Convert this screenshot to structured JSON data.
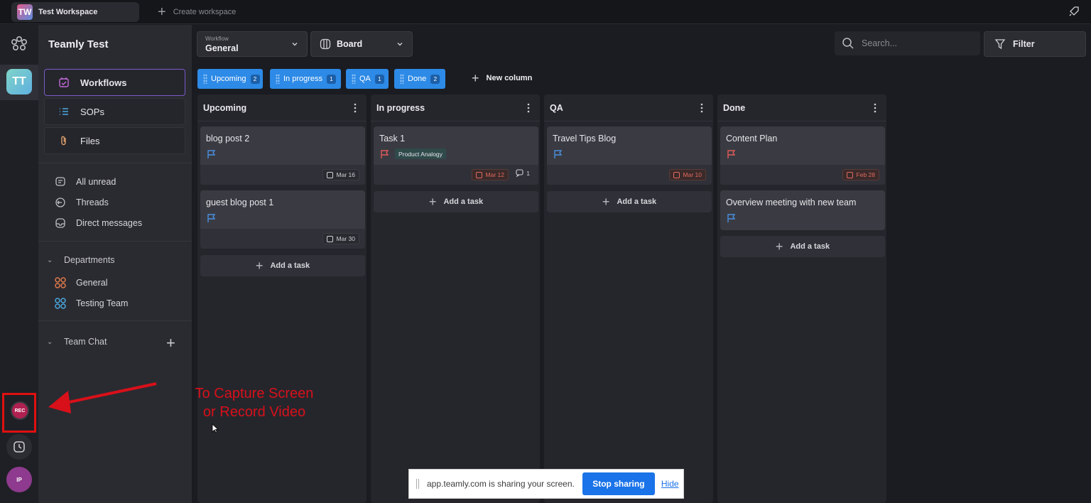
{
  "topbar": {
    "workspace_badge": "TW",
    "workspace_name": "Test Workspace",
    "create_workspace": "Create workspace"
  },
  "rail": {
    "team_badge": "TT",
    "rec_label": "REC",
    "avatar_initials": "IP"
  },
  "sidebar": {
    "title": "Teamly Test",
    "nav": [
      {
        "label": "Workflows",
        "icon": "workflow-icon"
      },
      {
        "label": "SOPs",
        "icon": "list-icon"
      },
      {
        "label": "Files",
        "icon": "paperclip-icon"
      }
    ],
    "messages": [
      {
        "label": "All unread",
        "icon": "message-icon"
      },
      {
        "label": "Threads",
        "icon": "thread-icon"
      },
      {
        "label": "Direct messages",
        "icon": "inbox-icon"
      }
    ],
    "departments_label": "Departments",
    "departments": [
      {
        "label": "General",
        "color": "#e07a4a"
      },
      {
        "label": "Testing Team",
        "color": "#4aa8e0"
      }
    ],
    "team_chat_label": "Team Chat"
  },
  "toolbar": {
    "workflow_label": "Workflow",
    "workflow_value": "General",
    "view_value": "Board",
    "search_placeholder": "Search...",
    "filter_label": "Filter"
  },
  "column_chips": [
    {
      "label": "Upcoming",
      "count": "2"
    },
    {
      "label": "In progress",
      "count": "1"
    },
    {
      "label": "QA",
      "count": "1"
    },
    {
      "label": "Done",
      "count": "2"
    }
  ],
  "new_column_label": "New column",
  "columns": [
    {
      "name": "Upcoming",
      "cards": [
        {
          "title": "blog post 2",
          "date": "Mar 16"
        },
        {
          "title": "guest blog post 1",
          "date": "Mar 30"
        }
      ],
      "add_task": "Add a task"
    },
    {
      "name": "In progress",
      "cards": [
        {
          "title": "Task 1",
          "tag": "Product Analogy",
          "date": "Mar 12",
          "comments": "1"
        }
      ],
      "add_task": "Add a task"
    },
    {
      "name": "QA",
      "cards": [
        {
          "title": "Travel Tips Blog",
          "date": "Mar 10"
        }
      ],
      "add_task": "Add a task"
    },
    {
      "name": "Done",
      "cards": [
        {
          "title": "Content Plan",
          "date": "Feb 28"
        },
        {
          "title": "Overview meeting with new team"
        }
      ],
      "add_task": "Add a task"
    }
  ],
  "annotation": {
    "line1": "To Capture Screen",
    "line2": "or Record Video",
    "color": "#d8101a"
  },
  "share_bar": {
    "message": "app.teamly.com is sharing your screen.",
    "stop_label": "Stop sharing",
    "hide_label": "Hide"
  },
  "colors": {
    "accent_blue": "#2d8ae6",
    "flag_blue": "#4a8fe0",
    "flag_red": "#e05a5a",
    "overdue_red": "#e36a5e"
  }
}
